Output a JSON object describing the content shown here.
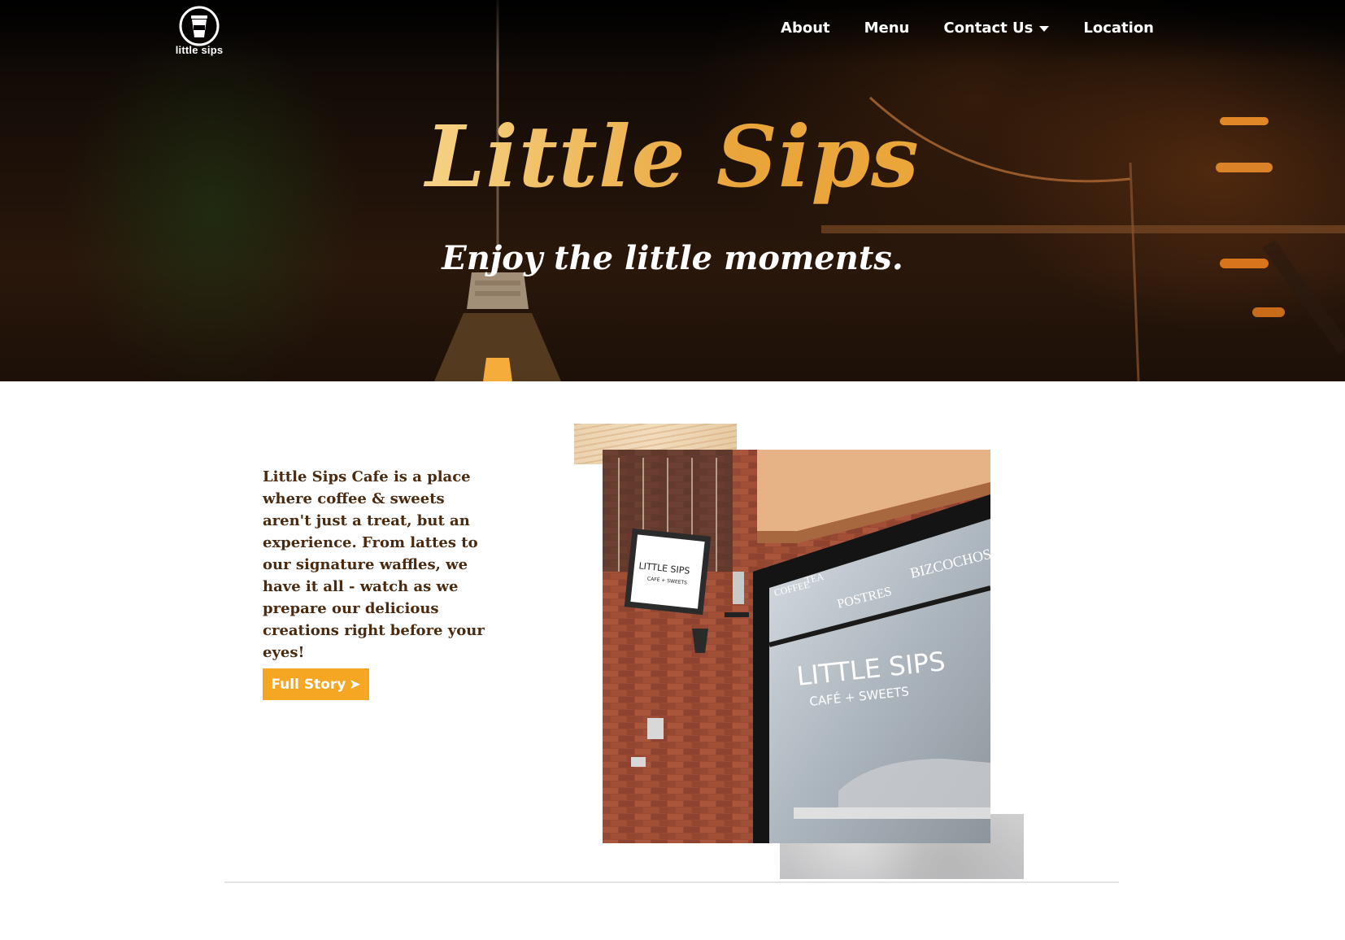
{
  "header": {
    "logo_text": "little sips",
    "nav": [
      {
        "label": "About"
      },
      {
        "label": "Menu"
      },
      {
        "label": "Contact Us"
      },
      {
        "label": "Location"
      }
    ]
  },
  "hero": {
    "title": "Little Sips",
    "tagline": "Enjoy the little moments."
  },
  "about": {
    "text": "Little Sips Cafe is a place where coffee & sweets aren't just a treat, but an experience. From lattes to our signature waffles, we have it all - watch as we prepare our delicious creations right before your eyes!",
    "button_label": "Full Story",
    "button_arrow": "➤"
  },
  "storefront": {
    "sign_title": "LITTLE SIPS",
    "sign_sub": "CAFÉ + SWEETS",
    "window_title": "LITTLE SIPS",
    "window_sub": "CAFÉ + SWEETS",
    "window_words": [
      "COFFEE",
      "TEA",
      "POSTRES",
      "BIZCOCHOS"
    ]
  },
  "colors": {
    "accent": "#f5a623",
    "text_brown": "#4a2a10",
    "hero_gold": "#e9a53a"
  }
}
